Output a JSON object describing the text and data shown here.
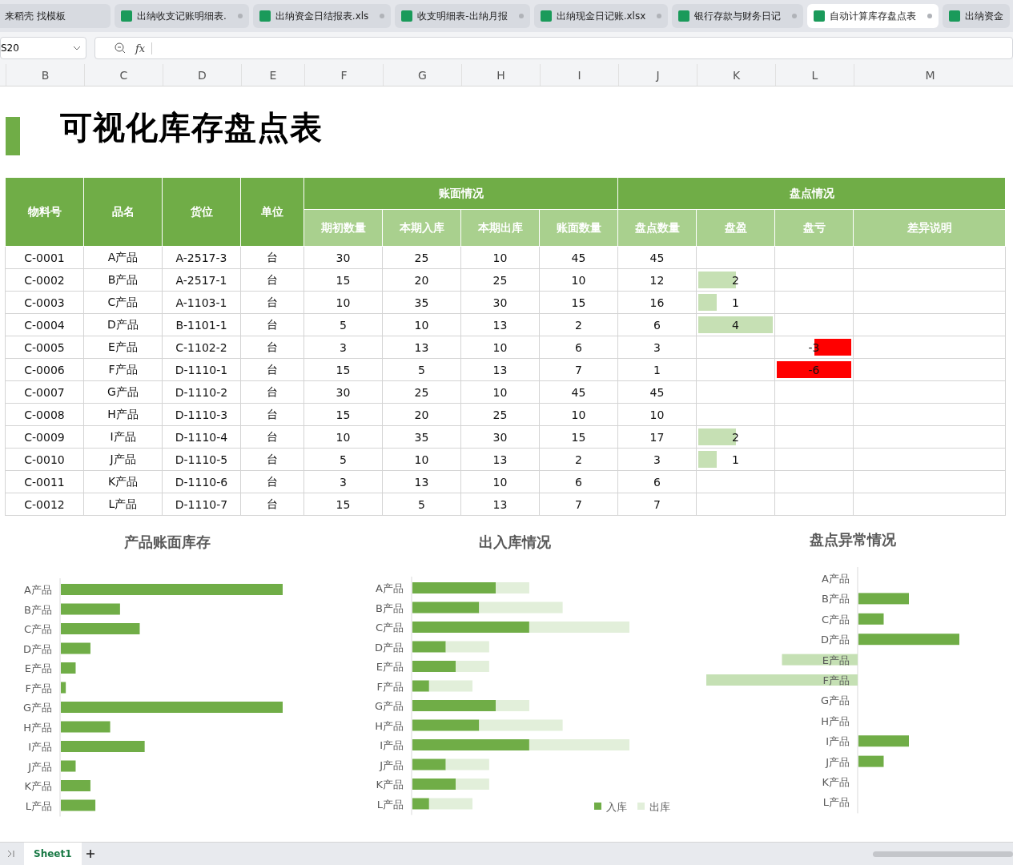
{
  "tabs": [
    {
      "kind": "home",
      "label": "来稻壳 找模板",
      "selected": false
    },
    {
      "kind": "file",
      "label": "出纳收支记账明细表.",
      "selected": false
    },
    {
      "kind": "file",
      "label": "出纳资金日结报表.xls",
      "selected": false
    },
    {
      "kind": "file",
      "label": "收支明细表-出纳月报",
      "selected": false
    },
    {
      "kind": "file",
      "label": "出纳现金日记账.xlsx",
      "selected": false
    },
    {
      "kind": "file",
      "label": "银行存款与财务日记",
      "selected": false
    },
    {
      "kind": "file",
      "label": "自动计算库存盘点表",
      "selected": true
    },
    {
      "kind": "file_cut",
      "label": "出纳资金",
      "selected": false
    }
  ],
  "formula_bar": {
    "cell": "S20",
    "fx": "fx"
  },
  "columns": [
    "B",
    "C",
    "D",
    "E",
    "F",
    "G",
    "H",
    "I",
    "J",
    "K",
    "L",
    "M"
  ],
  "title": "可视化库存盘点表",
  "table": {
    "fixed_headers": [
      "物料号",
      "品名",
      "货位",
      "单位"
    ],
    "groups": [
      {
        "label": "账面情况",
        "columns": [
          "期初数量",
          "本期入库",
          "本期出库",
          "账面数量"
        ]
      },
      {
        "label": "盘点情况",
        "columns": [
          "盘点数量",
          "盘盈",
          "盘亏",
          "差异说明"
        ]
      }
    ],
    "rows": [
      {
        "cells": [
          "C-0001",
          "A产品",
          "A-2517-3",
          "台",
          "30",
          "25",
          "10",
          "45",
          "45"
        ]
      },
      {
        "cells": [
          "C-0002",
          "B产品",
          "A-2517-1",
          "台",
          "15",
          "20",
          "25",
          "10",
          "12"
        ],
        "surplus": {
          "text": "2",
          "level": 0.5
        }
      },
      {
        "cells": [
          "C-0003",
          "C产品",
          "A-1103-1",
          "台",
          "10",
          "35",
          "30",
          "15",
          "16"
        ],
        "surplus": {
          "text": "1",
          "level": 0.25
        }
      },
      {
        "cells": [
          "C-0004",
          "D产品",
          "B-1101-1",
          "台",
          "5",
          "10",
          "13",
          "2",
          "6"
        ],
        "surplus": {
          "text": "4",
          "level": 1
        }
      },
      {
        "cells": [
          "C-0005",
          "E产品",
          "C-1102-2",
          "台",
          "3",
          "13",
          "10",
          "6",
          "3"
        ],
        "loss": {
          "text": "-3",
          "level": 0.5
        }
      },
      {
        "cells": [
          "C-0006",
          "F产品",
          "D-1110-1",
          "台",
          "15",
          "5",
          "13",
          "7",
          "1"
        ],
        "loss": {
          "text": "-6",
          "level": 1
        }
      },
      {
        "cells": [
          "C-0007",
          "G产品",
          "D-1110-2",
          "台",
          "30",
          "25",
          "10",
          "45",
          "45"
        ]
      },
      {
        "cells": [
          "C-0008",
          "H产品",
          "D-1110-3",
          "台",
          "15",
          "20",
          "25",
          "10",
          "10"
        ]
      },
      {
        "cells": [
          "C-0009",
          "I产品",
          "D-1110-4",
          "台",
          "10",
          "35",
          "30",
          "15",
          "17"
        ],
        "surplus": {
          "text": "2",
          "level": 0.5
        }
      },
      {
        "cells": [
          "C-0010",
          "J产品",
          "D-1110-5",
          "台",
          "5",
          "10",
          "13",
          "2",
          "3"
        ],
        "surplus": {
          "text": "1",
          "level": 0.25
        }
      },
      {
        "cells": [
          "C-0011",
          "K产品",
          "D-1110-6",
          "台",
          "3",
          "13",
          "10",
          "6",
          "6"
        ]
      },
      {
        "cells": [
          "C-0012",
          "L产品",
          "D-1110-7",
          "台",
          "15",
          "5",
          "13",
          "7",
          "7"
        ]
      }
    ]
  },
  "charts": [
    {
      "kind": "stock",
      "title": "产品账面库存",
      "categories": [
        "A产品",
        "B产品",
        "C产品",
        "D产品",
        "E产品",
        "F产品",
        "G产品",
        "H产品",
        "I产品",
        "J产品",
        "K产品",
        "L产品"
      ]
    },
    {
      "kind": "flow",
      "title": "出入库情况",
      "categories": [
        "A产品",
        "B产品",
        "C产品",
        "D产品",
        "E产品",
        "F产品",
        "G产品",
        "H产品",
        "I产品",
        "J产品",
        "K产品",
        "L产品"
      ],
      "legend": [
        {
          "label": "入库",
          "color": "#70ad47"
        },
        {
          "label": "出库",
          "color": "#e2efda"
        }
      ]
    },
    {
      "kind": "variance",
      "title": "盘点异常情况",
      "categories": [
        "A产品",
        "B产品",
        "C产品",
        "D产品",
        "E产品",
        "F产品",
        "G产品",
        "H产品",
        "I产品",
        "J产品",
        "K产品",
        "L产品"
      ]
    }
  ],
  "sheets": [
    {
      "label": "Sheet1",
      "selected": true
    }
  ]
}
